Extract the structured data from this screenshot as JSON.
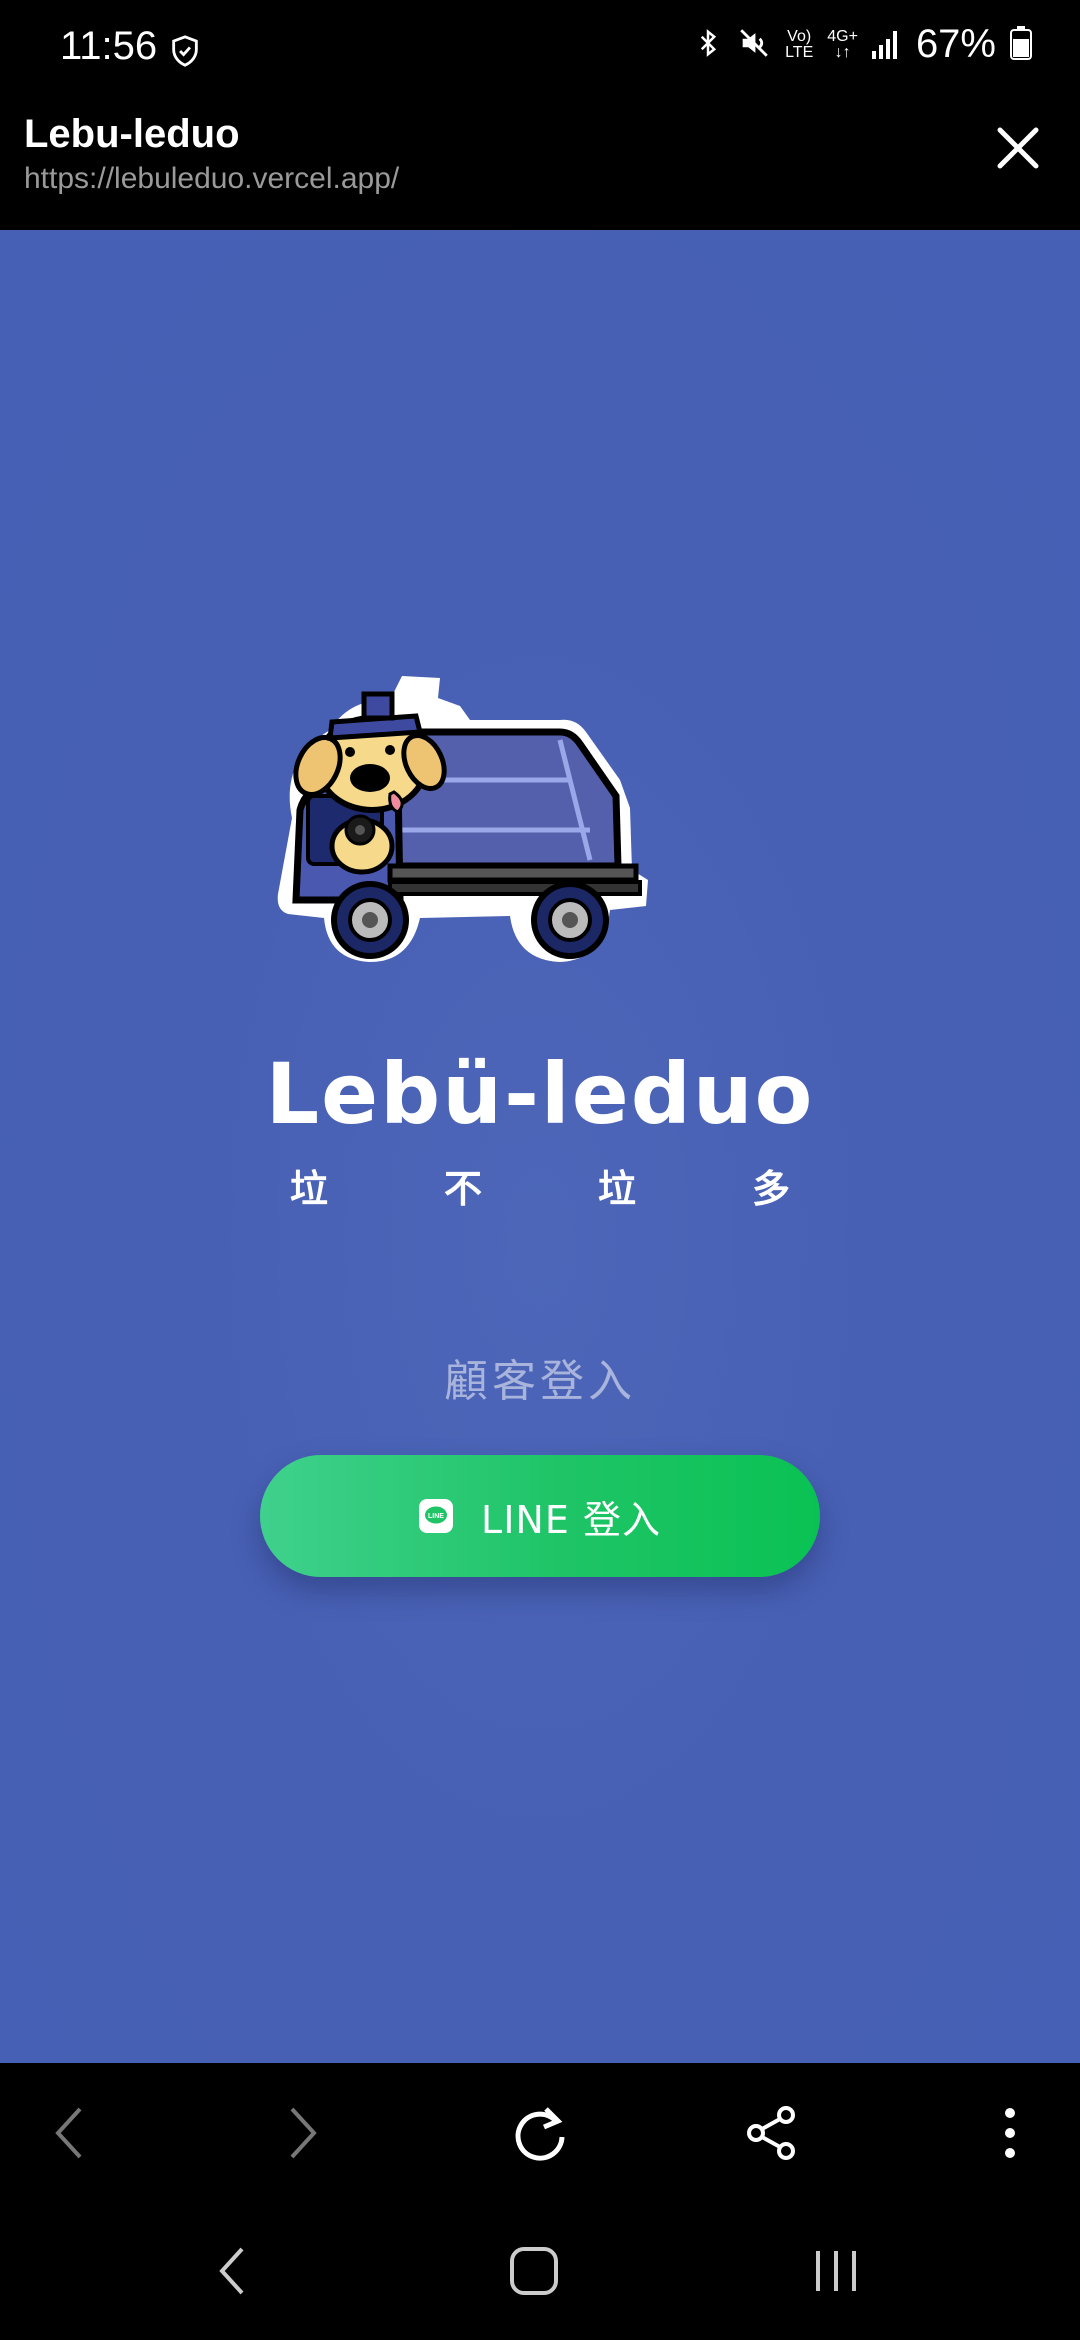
{
  "status_bar": {
    "time": "11:56",
    "volte": "Vo)",
    "lte": "LTE",
    "network": "4G+",
    "battery_percent": "67%"
  },
  "browser": {
    "title": "Lebu-leduo",
    "url": "https://lebuleduo.vercel.app/"
  },
  "app": {
    "brand_title": "Lebü-leduo",
    "brand_subtitle": [
      "垃",
      "不",
      "垃",
      "多"
    ],
    "login_label": "顧客登入",
    "line_button_label": "LINE 登入",
    "line_icon_text": "LINE"
  },
  "colors": {
    "background": "#4860b4",
    "line_green": "#06c755",
    "login_label": "#a9b4dc"
  },
  "icons": {
    "status": [
      "shield-icon",
      "bluetooth-icon",
      "mute-icon",
      "signal-icon",
      "battery-icon"
    ],
    "toolbar": [
      "back-arrow-icon",
      "forward-arrow-icon",
      "reload-icon",
      "share-icon",
      "more-vert-icon"
    ],
    "system_nav": [
      "nav-back-icon",
      "nav-home-icon",
      "nav-recents-icon"
    ]
  }
}
